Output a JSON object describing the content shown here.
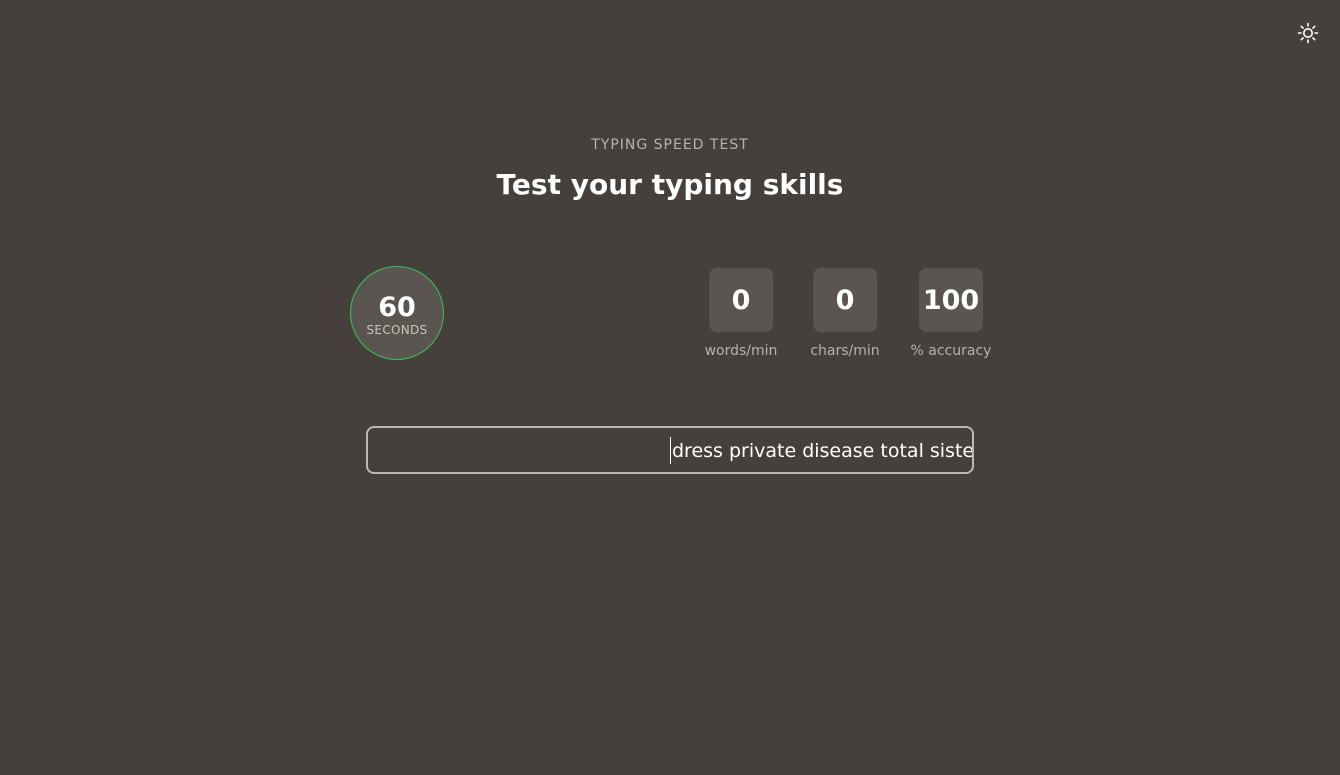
{
  "header": {
    "eyebrow": "TYPING SPEED TEST",
    "title": "Test your typing skills"
  },
  "timer": {
    "value": "60",
    "label": "SECONDS",
    "ring_color": "#37c25a"
  },
  "stats": [
    {
      "value": "0",
      "label": "words/min"
    },
    {
      "value": "0",
      "label": "chars/min"
    },
    {
      "value": "100",
      "label": "% accuracy"
    }
  ],
  "typing": {
    "upcoming_text": "dress private disease total sister ac"
  },
  "theme_toggle": {
    "icon": "sun-icon"
  },
  "colors": {
    "background": "#45403b",
    "panel": "#5a5550",
    "accent": "#37c25a"
  }
}
